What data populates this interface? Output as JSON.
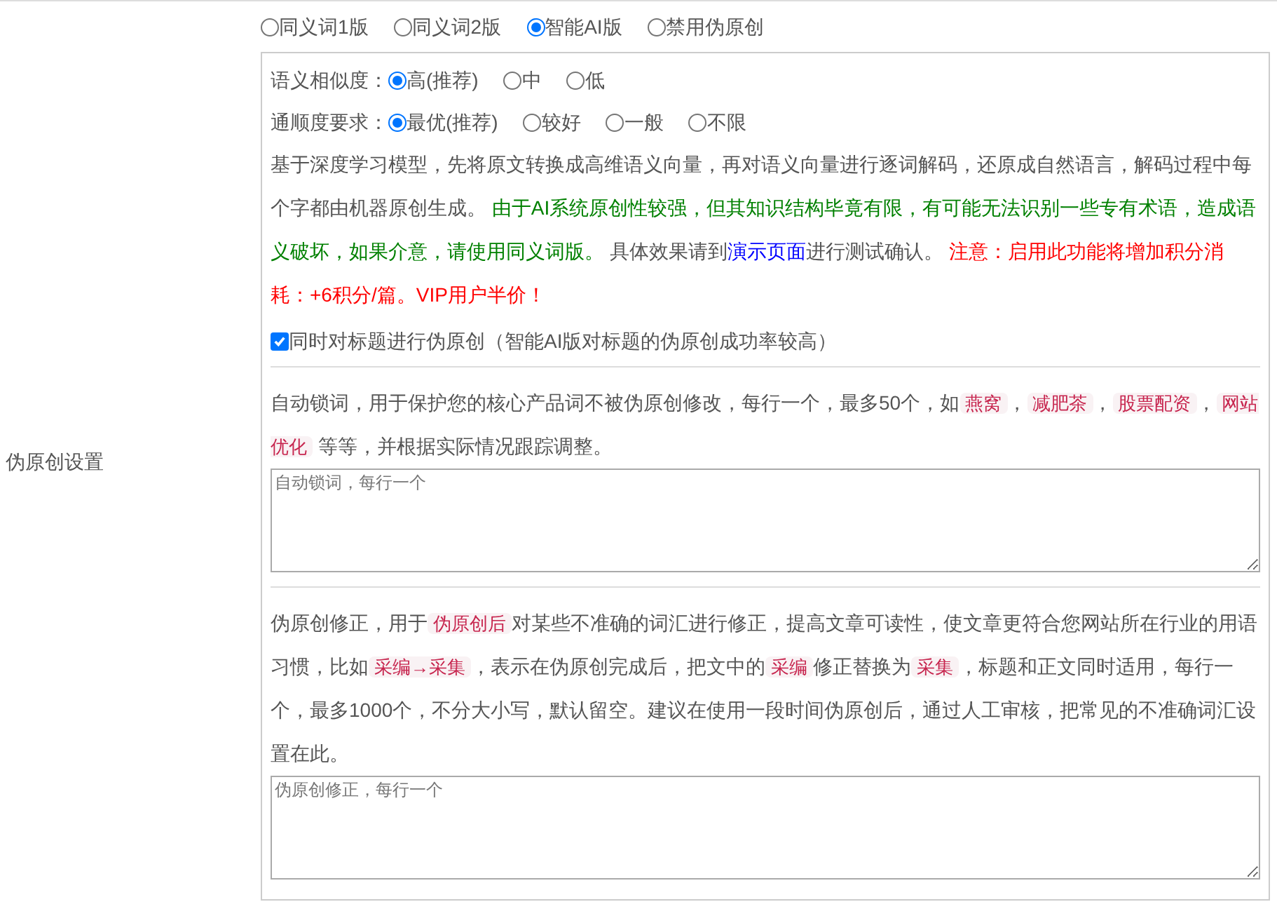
{
  "section_label": "伪原创设置",
  "mode_options": [
    {
      "label": "同义词1版",
      "selected": false
    },
    {
      "label": "同义词2版",
      "selected": false
    },
    {
      "label": "智能AI版",
      "selected": true
    },
    {
      "label": "禁用伪原创",
      "selected": false
    }
  ],
  "similarity": {
    "label": "语义相似度：",
    "options": [
      {
        "label": "高(推荐)",
        "selected": true
      },
      {
        "label": "中",
        "selected": false
      },
      {
        "label": "低",
        "selected": false
      }
    ]
  },
  "fluency": {
    "label": "通顺度要求：",
    "options": [
      {
        "label": "最优(推荐)",
        "selected": true
      },
      {
        "label": "较好",
        "selected": false
      },
      {
        "label": "一般",
        "selected": false
      },
      {
        "label": "不限",
        "selected": false
      }
    ]
  },
  "ai_description": [
    {
      "kind": "plain",
      "text": "基于深度学习模型，先将原文转换成高维语义向量，再对语义向量进行逐词解码，还原成自然语言，解码过程中每个字都由机器原创生成。 "
    },
    {
      "kind": "note",
      "text": "由于AI系统原创性较强，但其知识结构毕竟有限，有可能无法识别一些专有术语，造成语义破坏，如果介意，请使用同义词版。"
    },
    {
      "kind": "plain",
      "text": " 具体效果请到"
    },
    {
      "kind": "link",
      "text": "演示页面"
    },
    {
      "kind": "plain",
      "text": "进行测试确认。 "
    },
    {
      "kind": "warning",
      "text": "注意：启用此功能将增加积分消耗：+6积分/篇。VIP用户半价！"
    }
  ],
  "title_checkbox": {
    "label": "同时对标题进行伪原创（智能AI版对标题的伪原创成功率较高）",
    "checked": true
  },
  "lock_words": {
    "description": [
      {
        "kind": "plain",
        "text": "自动锁词，用于保护您的核心产品词不被伪原创修改，每行一个，最多50个，如"
      },
      {
        "kind": "code",
        "text": "燕窝"
      },
      {
        "kind": "plain",
        "text": "，"
      },
      {
        "kind": "code",
        "text": "减肥茶"
      },
      {
        "kind": "plain",
        "text": "，"
      },
      {
        "kind": "code",
        "text": "股票配资"
      },
      {
        "kind": "plain",
        "text": "，"
      },
      {
        "kind": "code",
        "text": "网站优化"
      },
      {
        "kind": "plain",
        "text": " 等等，并根据实际情况跟踪调整。"
      }
    ],
    "placeholder": "自动锁词，每行一个"
  },
  "correction": {
    "description": [
      {
        "kind": "plain",
        "text": "伪原创修正，用于"
      },
      {
        "kind": "code",
        "text": "伪原创后"
      },
      {
        "kind": "plain",
        "text": "对某些不准确的词汇进行修正，提高文章可读性，使文章更符合您网站所在行业的用语习惯，比如"
      },
      {
        "kind": "code",
        "text": "采编→采集"
      },
      {
        "kind": "plain",
        "text": "，表示在伪原创完成后，把文中的"
      },
      {
        "kind": "code",
        "text": "采编"
      },
      {
        "kind": "plain",
        "text": "修正替换为"
      },
      {
        "kind": "code",
        "text": "采集"
      },
      {
        "kind": "plain",
        "text": "，标题和正文同时适用，每行一个，最多1000个，不分大小写，默认留空。建议在使用一段时间伪原创后，通过人工审核，把常见的不准确词汇设置在此。"
      }
    ],
    "placeholder": "伪原创修正，每行一个"
  }
}
